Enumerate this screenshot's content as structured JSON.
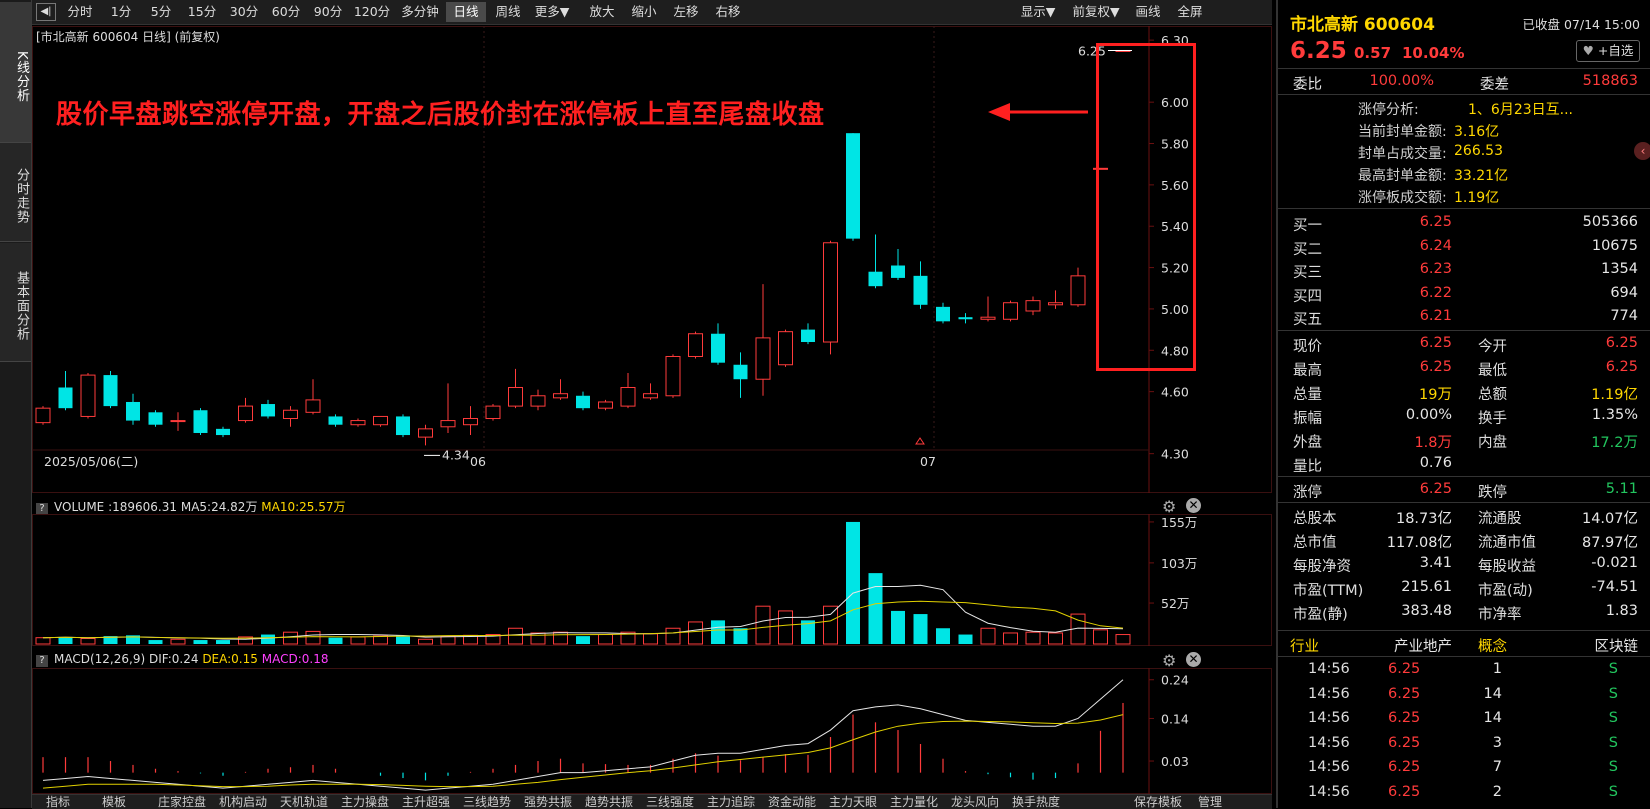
{
  "left_tabs": [
    "K线分析",
    "分时走势",
    "基本面分析"
  ],
  "toolbar": {
    "periods": [
      "分时",
      "1分",
      "5分",
      "15分",
      "30分",
      "60分",
      "90分",
      "120分",
      "多分钟",
      "日线",
      "周线",
      "更多▼"
    ],
    "tools": [
      "放大",
      "缩小",
      "左移",
      "右移"
    ],
    "right": [
      "显示▼",
      "前复权▼",
      "画线",
      "全屏"
    ]
  },
  "main_chart": {
    "title": "[市北高新 600604 日线]  (前复权)",
    "annotation": "股价早盘跳空涨停开盘，开盘之后股价封在涨停板上直至尾盘收盘",
    "price_label_high": "6.25",
    "price_label_low": "4.34",
    "y_ticks": [
      "6.30",
      "6.00",
      "5.80",
      "5.60",
      "5.40",
      "5.20",
      "5.00",
      "4.80",
      "4.60",
      "4.30"
    ],
    "x_labels": [
      "2025/05/06(二)",
      "06",
      "07"
    ]
  },
  "volume": {
    "header_name": "VOLUME",
    "header_value": ":189606.31",
    "ma5": "MA5:24.82万",
    "ma10": "MA10:25.57万",
    "y_ticks": [
      "155万",
      "103万",
      "52万"
    ]
  },
  "macd": {
    "header_name": "MACD(12,26,9)",
    "dif": "DIF:0.24",
    "dea": "DEA:0.15",
    "macd_val": "MACD:0.18",
    "y_ticks": [
      "0.24",
      "0.14",
      "0.03"
    ]
  },
  "chart_data": {
    "type": "candlestick",
    "title": "[市北高新 600604 日线]  (前复权)",
    "ylim": [
      4.25,
      6.32
    ],
    "candles": [
      {
        "o": 4.45,
        "c": 4.52,
        "h": 4.53,
        "l": 4.44,
        "up": true
      },
      {
        "o": 4.62,
        "c": 4.52,
        "h": 4.7,
        "l": 4.51,
        "up": false
      },
      {
        "o": 4.48,
        "c": 4.68,
        "h": 4.69,
        "l": 4.47,
        "up": true
      },
      {
        "o": 4.68,
        "c": 4.53,
        "h": 4.7,
        "l": 4.52,
        "up": false
      },
      {
        "o": 4.55,
        "c": 4.46,
        "h": 4.59,
        "l": 4.44,
        "up": false
      },
      {
        "o": 4.5,
        "c": 4.44,
        "h": 4.51,
        "l": 4.43,
        "up": false
      },
      {
        "o": 4.46,
        "c": 4.46,
        "h": 4.5,
        "l": 4.41,
        "up": true
      },
      {
        "o": 4.51,
        "c": 4.4,
        "h": 4.52,
        "l": 4.39,
        "up": false
      },
      {
        "o": 4.42,
        "c": 4.39,
        "h": 4.43,
        "l": 4.38,
        "up": false
      },
      {
        "o": 4.46,
        "c": 4.53,
        "h": 4.57,
        "l": 4.45,
        "up": true
      },
      {
        "o": 4.54,
        "c": 4.48,
        "h": 4.56,
        "l": 4.47,
        "up": false
      },
      {
        "o": 4.47,
        "c": 4.51,
        "h": 4.53,
        "l": 4.43,
        "up": true
      },
      {
        "o": 4.5,
        "c": 4.56,
        "h": 4.66,
        "l": 4.49,
        "up": true
      },
      {
        "o": 4.48,
        "c": 4.44,
        "h": 4.49,
        "l": 4.43,
        "up": false
      },
      {
        "o": 4.44,
        "c": 4.46,
        "h": 4.47,
        "l": 4.43,
        "up": true
      },
      {
        "o": 4.44,
        "c": 4.48,
        "h": 4.48,
        "l": 4.43,
        "up": true
      },
      {
        "o": 4.48,
        "c": 4.39,
        "h": 4.49,
        "l": 4.38,
        "up": false
      },
      {
        "o": 4.38,
        "c": 4.42,
        "h": 4.44,
        "l": 4.34,
        "up": true
      },
      {
        "o": 4.43,
        "c": 4.46,
        "h": 4.64,
        "l": 4.4,
        "up": true
      },
      {
        "o": 4.44,
        "c": 4.47,
        "h": 4.53,
        "l": 4.39,
        "up": true
      },
      {
        "o": 4.47,
        "c": 4.53,
        "h": 4.54,
        "l": 4.46,
        "up": true
      },
      {
        "o": 4.53,
        "c": 4.62,
        "h": 4.71,
        "l": 4.52,
        "up": true
      },
      {
        "o": 4.53,
        "c": 4.58,
        "h": 4.61,
        "l": 4.51,
        "up": true
      },
      {
        "o": 4.57,
        "c": 4.59,
        "h": 4.66,
        "l": 4.56,
        "up": true
      },
      {
        "o": 4.58,
        "c": 4.52,
        "h": 4.6,
        "l": 4.51,
        "up": false
      },
      {
        "o": 4.52,
        "c": 4.55,
        "h": 4.56,
        "l": 4.51,
        "up": true
      },
      {
        "o": 4.53,
        "c": 4.62,
        "h": 4.69,
        "l": 4.52,
        "up": true
      },
      {
        "o": 4.57,
        "c": 4.59,
        "h": 4.64,
        "l": 4.56,
        "up": true
      },
      {
        "o": 4.58,
        "c": 4.77,
        "h": 4.78,
        "l": 4.57,
        "up": true
      },
      {
        "o": 4.77,
        "c": 4.88,
        "h": 4.89,
        "l": 4.76,
        "up": true
      },
      {
        "o": 4.88,
        "c": 4.74,
        "h": 4.93,
        "l": 4.73,
        "up": false
      },
      {
        "o": 4.73,
        "c": 4.66,
        "h": 4.79,
        "l": 4.57,
        "up": false
      },
      {
        "o": 4.66,
        "c": 4.86,
        "h": 5.12,
        "l": 4.58,
        "up": true
      },
      {
        "o": 4.73,
        "c": 4.89,
        "h": 4.9,
        "l": 4.72,
        "up": true
      },
      {
        "o": 4.9,
        "c": 4.84,
        "h": 4.93,
        "l": 4.83,
        "up": false
      },
      {
        "o": 4.84,
        "c": 5.32,
        "h": 5.33,
        "l": 4.78,
        "up": true
      },
      {
        "o": 5.85,
        "c": 5.34,
        "h": 5.85,
        "l": 5.33,
        "up": false
      },
      {
        "o": 5.18,
        "c": 5.11,
        "h": 5.36,
        "l": 5.1,
        "up": false
      },
      {
        "o": 5.21,
        "c": 5.15,
        "h": 5.29,
        "l": 5.14,
        "up": false
      },
      {
        "o": 5.16,
        "c": 5.02,
        "h": 5.23,
        "l": 5.0,
        "up": false
      },
      {
        "o": 5.01,
        "c": 4.94,
        "h": 5.03,
        "l": 4.93,
        "up": false
      },
      {
        "o": 4.96,
        "c": 4.95,
        "h": 4.98,
        "l": 4.93,
        "up": false
      },
      {
        "o": 4.95,
        "c": 4.96,
        "h": 5.06,
        "l": 4.94,
        "up": true
      },
      {
        "o": 4.95,
        "c": 5.03,
        "h": 5.04,
        "l": 4.94,
        "up": true
      },
      {
        "o": 4.99,
        "c": 5.04,
        "h": 5.06,
        "l": 4.97,
        "up": true
      },
      {
        "o": 5.02,
        "c": 5.03,
        "h": 5.09,
        "l": 5.0,
        "up": true
      },
      {
        "o": 5.02,
        "c": 5.16,
        "h": 5.2,
        "l": 5.01,
        "up": true
      },
      {
        "o": 5.68,
        "c": 5.68,
        "h": 5.68,
        "l": 5.68,
        "up": true
      },
      {
        "o": 6.25,
        "c": 6.25,
        "h": 6.25,
        "l": 6.25,
        "up": true
      }
    ],
    "volume": [
      8,
      9,
      7,
      10,
      11,
      5,
      6,
      5,
      5,
      9,
      12,
      15,
      16,
      8,
      9,
      10,
      11,
      6,
      10,
      11,
      12,
      20,
      14,
      15,
      10,
      12,
      15,
      13,
      20,
      28,
      30,
      20,
      48,
      42,
      30,
      48,
      155,
      90,
      42,
      38,
      20,
      12,
      20,
      14,
      15,
      14,
      38,
      18,
      12
    ],
    "volume_ylim": [
      0,
      160
    ],
    "macd_dif": [
      -0.02,
      -0.015,
      -0.01,
      -0.015,
      -0.02,
      -0.025,
      -0.03,
      -0.035,
      -0.04,
      -0.035,
      -0.03,
      -0.025,
      -0.02,
      -0.025,
      -0.03,
      -0.035,
      -0.04,
      -0.045,
      -0.04,
      -0.035,
      -0.03,
      -0.02,
      -0.01,
      0.0,
      0.0,
      0.005,
      0.01,
      0.015,
      0.03,
      0.045,
      0.05,
      0.05,
      0.06,
      0.07,
      0.075,
      0.11,
      0.16,
      0.17,
      0.175,
      0.165,
      0.15,
      0.135,
      0.13,
      0.125,
      0.12,
      0.12,
      0.14,
      0.19,
      0.24
    ],
    "macd_dea": [
      -0.04,
      -0.035,
      -0.03,
      -0.03,
      -0.03,
      -0.03,
      -0.032,
      -0.034,
      -0.036,
      -0.036,
      -0.035,
      -0.032,
      -0.03,
      -0.03,
      -0.03,
      -0.031,
      -0.033,
      -0.035,
      -0.036,
      -0.036,
      -0.035,
      -0.03,
      -0.025,
      -0.018,
      -0.012,
      -0.006,
      0.0,
      0.005,
      0.012,
      0.02,
      0.028,
      0.034,
      0.04,
      0.046,
      0.052,
      0.064,
      0.085,
      0.105,
      0.12,
      0.128,
      0.132,
      0.133,
      0.132,
      0.131,
      0.129,
      0.127,
      0.128,
      0.136,
      0.15
    ],
    "macd_ylim": [
      -0.05,
      0.26
    ]
  },
  "stock": {
    "name": "市北高新",
    "code": "600604",
    "status": "已收盘 07/14 15:00",
    "price": "6.25",
    "change": "0.57",
    "change_pct": "10.04%",
    "fav_btn": "+自选"
  },
  "weibi": {
    "label1": "委比",
    "val1": "100.00%",
    "label2": "委差",
    "val2": "518863"
  },
  "limit_info": [
    {
      "label": "涨停分析:",
      "value": "1、6月23日互..."
    },
    {
      "label": "当前封单金额:",
      "value": "3.16亿"
    },
    {
      "label": "封单占成交量:",
      "value": "266.53"
    },
    {
      "label": "最高封单金额:",
      "value": "33.21亿"
    },
    {
      "label": "涨停板成交额:",
      "value": "1.19亿"
    }
  ],
  "bids": [
    {
      "label": "买一",
      "price": "6.25",
      "vol": "505366"
    },
    {
      "label": "买二",
      "price": "6.24",
      "vol": "10675"
    },
    {
      "label": "买三",
      "price": "6.23",
      "vol": "1354"
    },
    {
      "label": "买四",
      "price": "6.22",
      "vol": "694"
    },
    {
      "label": "买五",
      "price": "6.21",
      "vol": "774"
    }
  ],
  "quote_rows": [
    {
      "l1": "现价",
      "v1": "6.25",
      "c1": "red",
      "l2": "今开",
      "v2": "6.25",
      "c2": "red"
    },
    {
      "l1": "最高",
      "v1": "6.25",
      "c1": "red",
      "l2": "最低",
      "v2": "6.25",
      "c2": "red"
    },
    {
      "l1": "总量",
      "v1": "19万",
      "c1": "yel",
      "l2": "总额",
      "v2": "1.19亿",
      "c2": "yel"
    },
    {
      "l1": "振幅",
      "v1": "0.00%",
      "c1": "wht",
      "l2": "换手",
      "v2": "1.35%",
      "c2": "wht"
    },
    {
      "l1": "外盘",
      "v1": "1.8万",
      "c1": "red",
      "l2": "内盘",
      "v2": "17.2万",
      "c2": "grn"
    },
    {
      "l1": "量比",
      "v1": "0.76",
      "c1": "wht",
      "l2": "",
      "v2": "",
      "c2": "wht"
    }
  ],
  "limit_rows": [
    {
      "l1": "涨停",
      "v1": "6.25",
      "c1": "red",
      "l2": "跌停",
      "v2": "5.11",
      "c2": "grn"
    }
  ],
  "fund_rows": [
    {
      "l1": "总股本",
      "v1": "18.73亿",
      "l2": "流通股",
      "v2": "14.07亿"
    },
    {
      "l1": "总市值",
      "v1": "117.08亿",
      "l2": "流通市值",
      "v2": "87.97亿"
    },
    {
      "l1": "每股净资",
      "v1": "3.41",
      "l2": "每股收益",
      "v2": "-0.021"
    },
    {
      "l1": "市盈(TTM)",
      "v1": "215.61",
      "l2": "市盈(动)",
      "v2": "-74.51"
    },
    {
      "l1": "市盈(静)",
      "v1": "383.48",
      "l2": "市净率",
      "v2": "1.83"
    }
  ],
  "industry": {
    "l1": "行业",
    "v1": "产业地产",
    "l2": "概念",
    "v2": "区块链"
  },
  "trades": [
    {
      "time": "14:56",
      "price": "6.25",
      "vol": "1",
      "side": "S"
    },
    {
      "time": "14:56",
      "price": "6.25",
      "vol": "14",
      "side": "S"
    },
    {
      "time": "14:56",
      "price": "6.25",
      "vol": "14",
      "side": "S"
    },
    {
      "time": "14:56",
      "price": "6.25",
      "vol": "3",
      "side": "S"
    },
    {
      "time": "14:56",
      "price": "6.25",
      "vol": "7",
      "side": "S"
    },
    {
      "time": "14:56",
      "price": "6.25",
      "vol": "2",
      "side": "S"
    }
  ],
  "bottom_tabs": [
    "指标",
    "模板",
    "庄家控盘",
    "机构启动",
    "天机轨道",
    "主力操盘",
    "主升超强",
    "三线趋势",
    "强势共振",
    "趋势共振",
    "三线强度",
    "主力追踪",
    "资金动能",
    "主力天眼",
    "主力量化",
    "龙头风向",
    "换手热度",
    "保存模板",
    "管理"
  ]
}
